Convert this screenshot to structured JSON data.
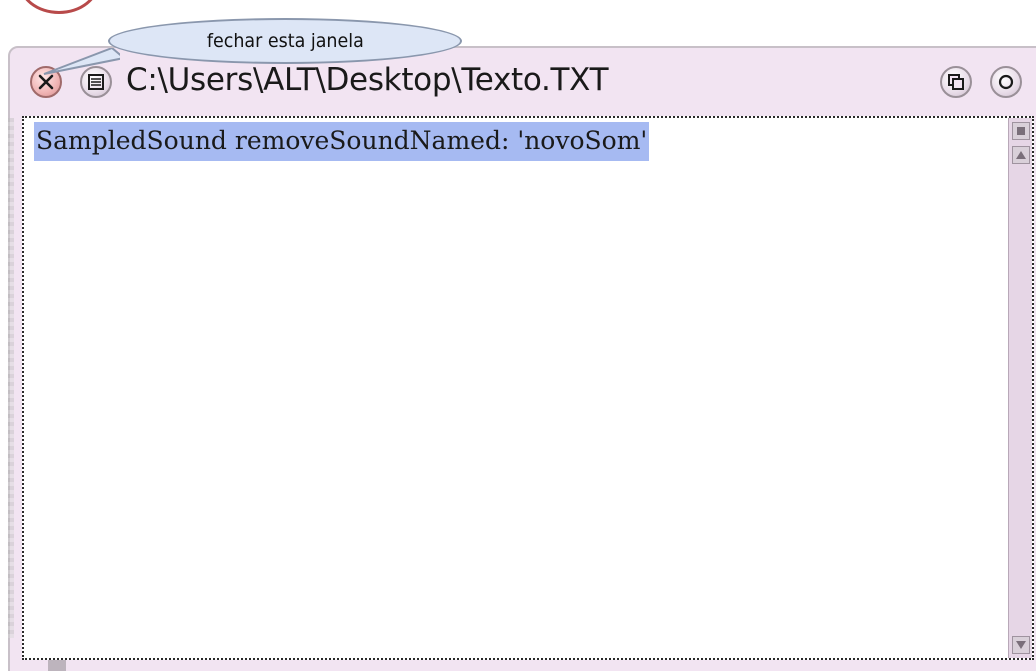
{
  "window": {
    "title": "C:\\Users\\ALT\\Desktop\\Texto.TXT",
    "close_tooltip": "fechar esta janela"
  },
  "editor": {
    "selected_text": "SampledSound removeSoundNamed: 'novoSom'"
  },
  "icons": {
    "close": "close-x-icon",
    "menu": "window-menu-icon",
    "collapse": "collapse-icon",
    "expand": "expand-icon",
    "scroll_menu": "scroll-menu-icon",
    "scroll_up": "arrow-up-icon",
    "scroll_down": "arrow-down-icon"
  },
  "colors": {
    "window_bg": "#f2e4f2",
    "selection": "#a6baf2",
    "tooltip_bg": "#dde6f6",
    "annotation_circle": "#b84a4a"
  }
}
